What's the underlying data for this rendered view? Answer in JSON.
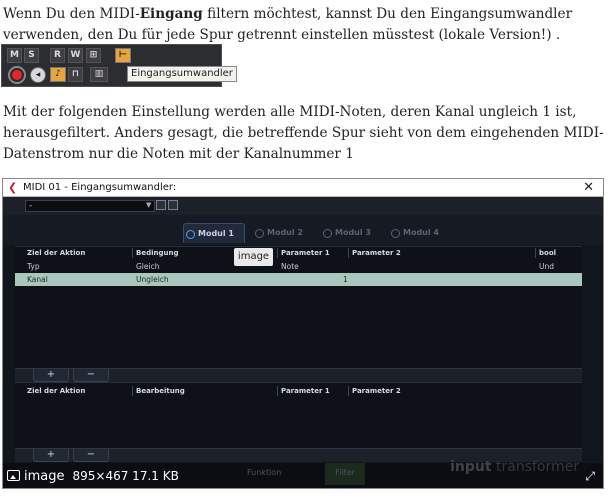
{
  "paragraphs": {
    "p1_a": "Wenn Du den MIDI-",
    "p1_bold": "Eingang",
    "p1_b": " filtern möchtest, kannst Du den Eingangsumwandler verwenden, den Du für jede Spur getrennt einstellen müsstest (lokale Version!) .",
    "p2": "Mit der folgenden Einstellung werden alle MIDI-Noten, deren Kanal ungleich 1 ist, herausgefiltert. Anders gesagt, die betreffende Spur sieht von dem eingehenden MIDI-Datenstrom nur die Noten mit der Kanalnummer 1"
  },
  "track_strip": {
    "buttons": [
      "M",
      "S",
      "R",
      "W",
      "⊞",
      "⊢"
    ],
    "tooltip": "Eingangsumwandler"
  },
  "dialog": {
    "title": "MIDI 01 - Eingangsumwandler:",
    "preset_value": "-",
    "tabs": [
      "Modul 1",
      "Modul 2",
      "Modul 3",
      "Modul 4"
    ],
    "image_badge": "image",
    "filter_headers": [
      "Ziel der Aktion",
      "Bedingung",
      "Parameter 1",
      "Parameter 2",
      "bool"
    ],
    "filter_rows": [
      {
        "target": "Typ",
        "condition": "Gleich",
        "param1": "Note",
        "param2": "",
        "bool": "Und"
      },
      {
        "target": "Kanal",
        "condition": "Ungleich",
        "param1": "1",
        "param2": "",
        "bool": ""
      }
    ],
    "add_label": "+",
    "remove_label": "−",
    "action_headers": [
      "Ziel der Aktion",
      "Bearbeitung",
      "Parameter 1",
      "Parameter 2"
    ],
    "footer_button_1": "Funktion",
    "footer_button_2": "Filter",
    "brand_a": "input",
    "brand_b": " transformer"
  },
  "image_overlay": {
    "label": "image",
    "info": "895×467 17.1 KB"
  }
}
